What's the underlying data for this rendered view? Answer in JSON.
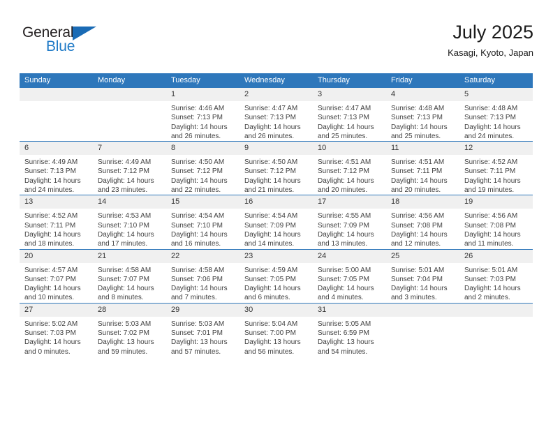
{
  "brand": {
    "name_part1": "General",
    "name_part2": "Blue",
    "accent_color": "#1f7ac7",
    "triangle_color": "#1a6bb5"
  },
  "header": {
    "month_title": "July 2025",
    "location": "Kasagi, Kyoto, Japan"
  },
  "calendar": {
    "header_color": "#2e77bb",
    "daynum_band_color": "#f0f0f0",
    "weekday_headers": [
      "Sunday",
      "Monday",
      "Tuesday",
      "Wednesday",
      "Thursday",
      "Friday",
      "Saturday"
    ],
    "weeks": [
      [
        {
          "day": "",
          "lines": []
        },
        {
          "day": "",
          "lines": []
        },
        {
          "day": "1",
          "lines": [
            "Sunrise: 4:46 AM",
            "Sunset: 7:13 PM",
            "Daylight: 14 hours",
            "and 26 minutes."
          ]
        },
        {
          "day": "2",
          "lines": [
            "Sunrise: 4:47 AM",
            "Sunset: 7:13 PM",
            "Daylight: 14 hours",
            "and 26 minutes."
          ]
        },
        {
          "day": "3",
          "lines": [
            "Sunrise: 4:47 AM",
            "Sunset: 7:13 PM",
            "Daylight: 14 hours",
            "and 25 minutes."
          ]
        },
        {
          "day": "4",
          "lines": [
            "Sunrise: 4:48 AM",
            "Sunset: 7:13 PM",
            "Daylight: 14 hours",
            "and 25 minutes."
          ]
        },
        {
          "day": "5",
          "lines": [
            "Sunrise: 4:48 AM",
            "Sunset: 7:13 PM",
            "Daylight: 14 hours",
            "and 24 minutes."
          ]
        }
      ],
      [
        {
          "day": "6",
          "lines": [
            "Sunrise: 4:49 AM",
            "Sunset: 7:13 PM",
            "Daylight: 14 hours",
            "and 24 minutes."
          ]
        },
        {
          "day": "7",
          "lines": [
            "Sunrise: 4:49 AM",
            "Sunset: 7:12 PM",
            "Daylight: 14 hours",
            "and 23 minutes."
          ]
        },
        {
          "day": "8",
          "lines": [
            "Sunrise: 4:50 AM",
            "Sunset: 7:12 PM",
            "Daylight: 14 hours",
            "and 22 minutes."
          ]
        },
        {
          "day": "9",
          "lines": [
            "Sunrise: 4:50 AM",
            "Sunset: 7:12 PM",
            "Daylight: 14 hours",
            "and 21 minutes."
          ]
        },
        {
          "day": "10",
          "lines": [
            "Sunrise: 4:51 AM",
            "Sunset: 7:12 PM",
            "Daylight: 14 hours",
            "and 20 minutes."
          ]
        },
        {
          "day": "11",
          "lines": [
            "Sunrise: 4:51 AM",
            "Sunset: 7:11 PM",
            "Daylight: 14 hours",
            "and 20 minutes."
          ]
        },
        {
          "day": "12",
          "lines": [
            "Sunrise: 4:52 AM",
            "Sunset: 7:11 PM",
            "Daylight: 14 hours",
            "and 19 minutes."
          ]
        }
      ],
      [
        {
          "day": "13",
          "lines": [
            "Sunrise: 4:52 AM",
            "Sunset: 7:11 PM",
            "Daylight: 14 hours",
            "and 18 minutes."
          ]
        },
        {
          "day": "14",
          "lines": [
            "Sunrise: 4:53 AM",
            "Sunset: 7:10 PM",
            "Daylight: 14 hours",
            "and 17 minutes."
          ]
        },
        {
          "day": "15",
          "lines": [
            "Sunrise: 4:54 AM",
            "Sunset: 7:10 PM",
            "Daylight: 14 hours",
            "and 16 minutes."
          ]
        },
        {
          "day": "16",
          "lines": [
            "Sunrise: 4:54 AM",
            "Sunset: 7:09 PM",
            "Daylight: 14 hours",
            "and 14 minutes."
          ]
        },
        {
          "day": "17",
          "lines": [
            "Sunrise: 4:55 AM",
            "Sunset: 7:09 PM",
            "Daylight: 14 hours",
            "and 13 minutes."
          ]
        },
        {
          "day": "18",
          "lines": [
            "Sunrise: 4:56 AM",
            "Sunset: 7:08 PM",
            "Daylight: 14 hours",
            "and 12 minutes."
          ]
        },
        {
          "day": "19",
          "lines": [
            "Sunrise: 4:56 AM",
            "Sunset: 7:08 PM",
            "Daylight: 14 hours",
            "and 11 minutes."
          ]
        }
      ],
      [
        {
          "day": "20",
          "lines": [
            "Sunrise: 4:57 AM",
            "Sunset: 7:07 PM",
            "Daylight: 14 hours",
            "and 10 minutes."
          ]
        },
        {
          "day": "21",
          "lines": [
            "Sunrise: 4:58 AM",
            "Sunset: 7:07 PM",
            "Daylight: 14 hours",
            "and 8 minutes."
          ]
        },
        {
          "day": "22",
          "lines": [
            "Sunrise: 4:58 AM",
            "Sunset: 7:06 PM",
            "Daylight: 14 hours",
            "and 7 minutes."
          ]
        },
        {
          "day": "23",
          "lines": [
            "Sunrise: 4:59 AM",
            "Sunset: 7:05 PM",
            "Daylight: 14 hours",
            "and 6 minutes."
          ]
        },
        {
          "day": "24",
          "lines": [
            "Sunrise: 5:00 AM",
            "Sunset: 7:05 PM",
            "Daylight: 14 hours",
            "and 4 minutes."
          ]
        },
        {
          "day": "25",
          "lines": [
            "Sunrise: 5:01 AM",
            "Sunset: 7:04 PM",
            "Daylight: 14 hours",
            "and 3 minutes."
          ]
        },
        {
          "day": "26",
          "lines": [
            "Sunrise: 5:01 AM",
            "Sunset: 7:03 PM",
            "Daylight: 14 hours",
            "and 2 minutes."
          ]
        }
      ],
      [
        {
          "day": "27",
          "lines": [
            "Sunrise: 5:02 AM",
            "Sunset: 7:03 PM",
            "Daylight: 14 hours",
            "and 0 minutes."
          ]
        },
        {
          "day": "28",
          "lines": [
            "Sunrise: 5:03 AM",
            "Sunset: 7:02 PM",
            "Daylight: 13 hours",
            "and 59 minutes."
          ]
        },
        {
          "day": "29",
          "lines": [
            "Sunrise: 5:03 AM",
            "Sunset: 7:01 PM",
            "Daylight: 13 hours",
            "and 57 minutes."
          ]
        },
        {
          "day": "30",
          "lines": [
            "Sunrise: 5:04 AM",
            "Sunset: 7:00 PM",
            "Daylight: 13 hours",
            "and 56 minutes."
          ]
        },
        {
          "day": "31",
          "lines": [
            "Sunrise: 5:05 AM",
            "Sunset: 6:59 PM",
            "Daylight: 13 hours",
            "and 54 minutes."
          ]
        },
        {
          "day": "",
          "lines": []
        },
        {
          "day": "",
          "lines": []
        }
      ]
    ]
  }
}
